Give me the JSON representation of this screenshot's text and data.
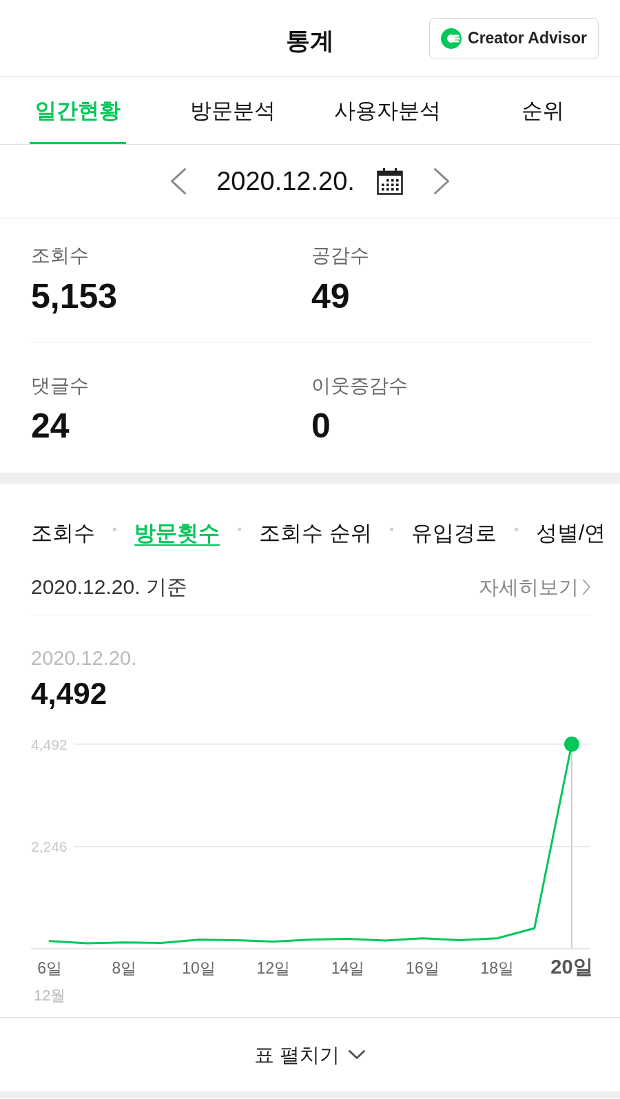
{
  "header": {
    "title": "통계",
    "advisor_button": "Creator Advisor"
  },
  "tabs": [
    {
      "label": "일간현황",
      "selected": true
    },
    {
      "label": "방문분석",
      "selected": false
    },
    {
      "label": "사용자분석",
      "selected": false
    },
    {
      "label": "순위",
      "selected": false
    }
  ],
  "date_nav": {
    "date": "2020.12.20."
  },
  "stats": [
    {
      "label": "조회수",
      "value": "5,153"
    },
    {
      "label": "공감수",
      "value": "49"
    },
    {
      "label": "댓글수",
      "value": "24"
    },
    {
      "label": "이웃증감수",
      "value": "0"
    }
  ],
  "report": {
    "subtabs": [
      {
        "label": "조회수",
        "selected": false
      },
      {
        "label": "방문횟수",
        "selected": true
      },
      {
        "label": "조회수 순위",
        "selected": false
      },
      {
        "label": "유입경로",
        "selected": false
      },
      {
        "label": "성별/연",
        "selected": false
      }
    ],
    "basis": "2020.12.20. 기준",
    "detail_link": "자세히보기",
    "readout": {
      "date": "2020.12.20.",
      "value": "4,492"
    },
    "chart_data": {
      "type": "line",
      "xlabel": "12월",
      "x": [
        6,
        7,
        8,
        9,
        10,
        11,
        12,
        13,
        14,
        15,
        16,
        17,
        18,
        19,
        20
      ],
      "xlim": [
        5.5,
        20.5
      ],
      "xticks": [
        {
          "value": 6,
          "label": "6일"
        },
        {
          "value": 8,
          "label": "8일"
        },
        {
          "value": 10,
          "label": "10일"
        },
        {
          "value": 12,
          "label": "12일"
        },
        {
          "value": 14,
          "label": "14일"
        },
        {
          "value": 16,
          "label": "16일"
        },
        {
          "value": 18,
          "label": "18일"
        },
        {
          "value": 20,
          "label": "20일"
        }
      ],
      "ylim": [
        0,
        4492
      ],
      "yticks": [
        {
          "value": 2246,
          "label": "2,246"
        },
        {
          "value": 4492,
          "label": "4,492"
        }
      ],
      "series": [
        {
          "color": "#03c75a",
          "values": [
            170,
            120,
            140,
            130,
            200,
            190,
            160,
            200,
            220,
            180,
            230,
            190,
            230,
            450,
            4492
          ]
        }
      ],
      "ref_lines": [
        {
          "axis": "x",
          "value": 20
        },
        {
          "axis": "y",
          "value": 2246
        }
      ]
    },
    "expand_button": "표 펼치기"
  }
}
